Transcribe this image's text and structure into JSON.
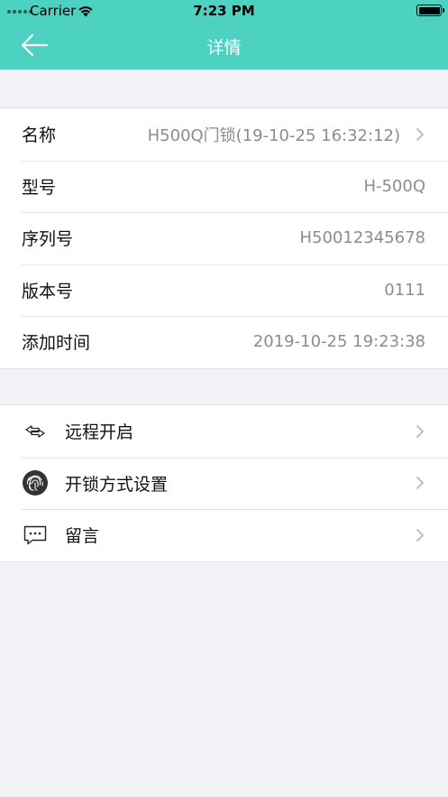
{
  "status_bar": {
    "carrier": "Carrier",
    "time": "7:23 PM"
  },
  "nav": {
    "title": "详情"
  },
  "details": [
    {
      "label": "名称",
      "value": "H500Q门锁(19-10-25 16:32:12)",
      "has_chevron": true
    },
    {
      "label": "型号",
      "value": "H-500Q",
      "has_chevron": false
    },
    {
      "label": "序列号",
      "value": "H50012345678",
      "has_chevron": false
    },
    {
      "label": "版本号",
      "value": "0111",
      "has_chevron": false
    },
    {
      "label": "添加时间",
      "value": "2019-10-25 19:23:38",
      "has_chevron": false
    }
  ],
  "actions": [
    {
      "label": "远程开启",
      "icon": "remote-arrows-icon"
    },
    {
      "label": "开锁方式设置",
      "icon": "fingerprint-icon"
    },
    {
      "label": "留言",
      "icon": "message-icon"
    }
  ],
  "colors": {
    "header": "#4dd2c2",
    "background": "#f2f2f6",
    "value_text": "#8c8c8c"
  }
}
